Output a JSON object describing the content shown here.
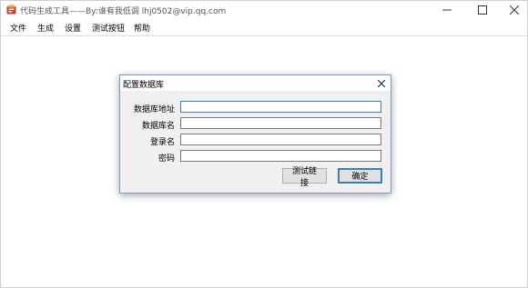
{
  "window": {
    "title": "代码生成工具——By:谁有我低调 lhj0502@vip.qq.com",
    "controls": [
      "minimize-icon",
      "maximize-icon",
      "close-icon"
    ]
  },
  "menu": [
    "文件",
    "生成",
    "设置",
    "测试按钮",
    "帮助"
  ],
  "dialog": {
    "title": "配置数据库",
    "fields": [
      {
        "label": "数据库地址",
        "value": ""
      },
      {
        "label": "数据库名",
        "value": ""
      },
      {
        "label": "登录名",
        "value": ""
      },
      {
        "label": "密码",
        "value": ""
      }
    ],
    "buttons": {
      "test": "测试链接",
      "ok": "确定"
    }
  },
  "colors": {
    "accent": "#3c7fb1",
    "dialog_bg": "#f0f0f0",
    "dialog_border": "#7a9cc6"
  }
}
